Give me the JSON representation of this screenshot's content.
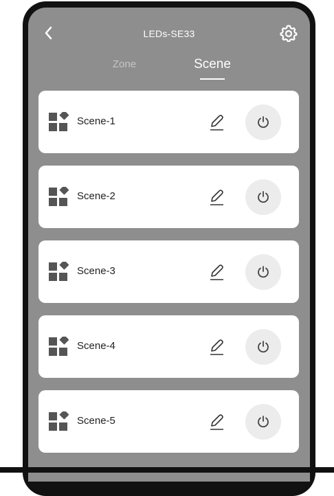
{
  "header": {
    "title": "LEDs-SE33",
    "back_icon": "chevron-left-icon",
    "settings_icon": "gear-icon"
  },
  "tabs": [
    {
      "label": "Zone",
      "active": false
    },
    {
      "label": "Scene",
      "active": true
    }
  ],
  "scenes": [
    {
      "label": "Scene-1"
    },
    {
      "label": "Scene-2"
    },
    {
      "label": "Scene-3"
    },
    {
      "label": "Scene-4"
    },
    {
      "label": "Scene-5"
    }
  ],
  "icons": {
    "scene": "scene-grid-icon",
    "edit": "pencil-icon",
    "power": "power-icon"
  },
  "colors": {
    "screen_bg": "#8e8e8e",
    "card_bg": "#ffffff",
    "power_bg": "#ececec",
    "active_tab": "#ffffff",
    "inactive_tab": "#c6c6c6"
  }
}
